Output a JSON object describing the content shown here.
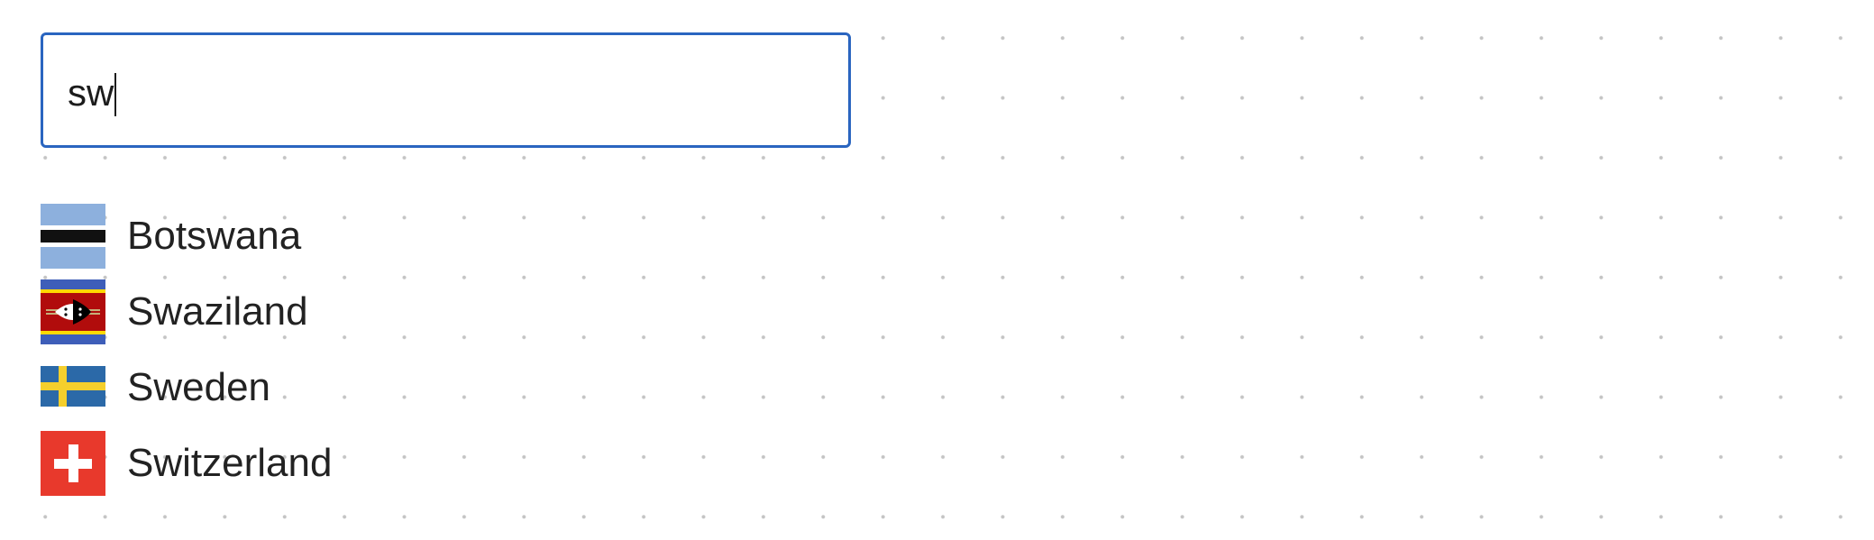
{
  "search": {
    "value": "sw"
  },
  "suggestions": [
    {
      "name": "Botswana",
      "flag_icon": "botswana-flag-icon"
    },
    {
      "name": "Swaziland",
      "flag_icon": "swaziland-flag-icon"
    },
    {
      "name": "Sweden",
      "flag_icon": "sweden-flag-icon"
    },
    {
      "name": "Switzerland",
      "flag_icon": "switzerland-flag-icon"
    }
  ],
  "colors": {
    "input_border": "#2a65c0",
    "text": "#222222",
    "grid_dot": "#c4c4c4"
  }
}
